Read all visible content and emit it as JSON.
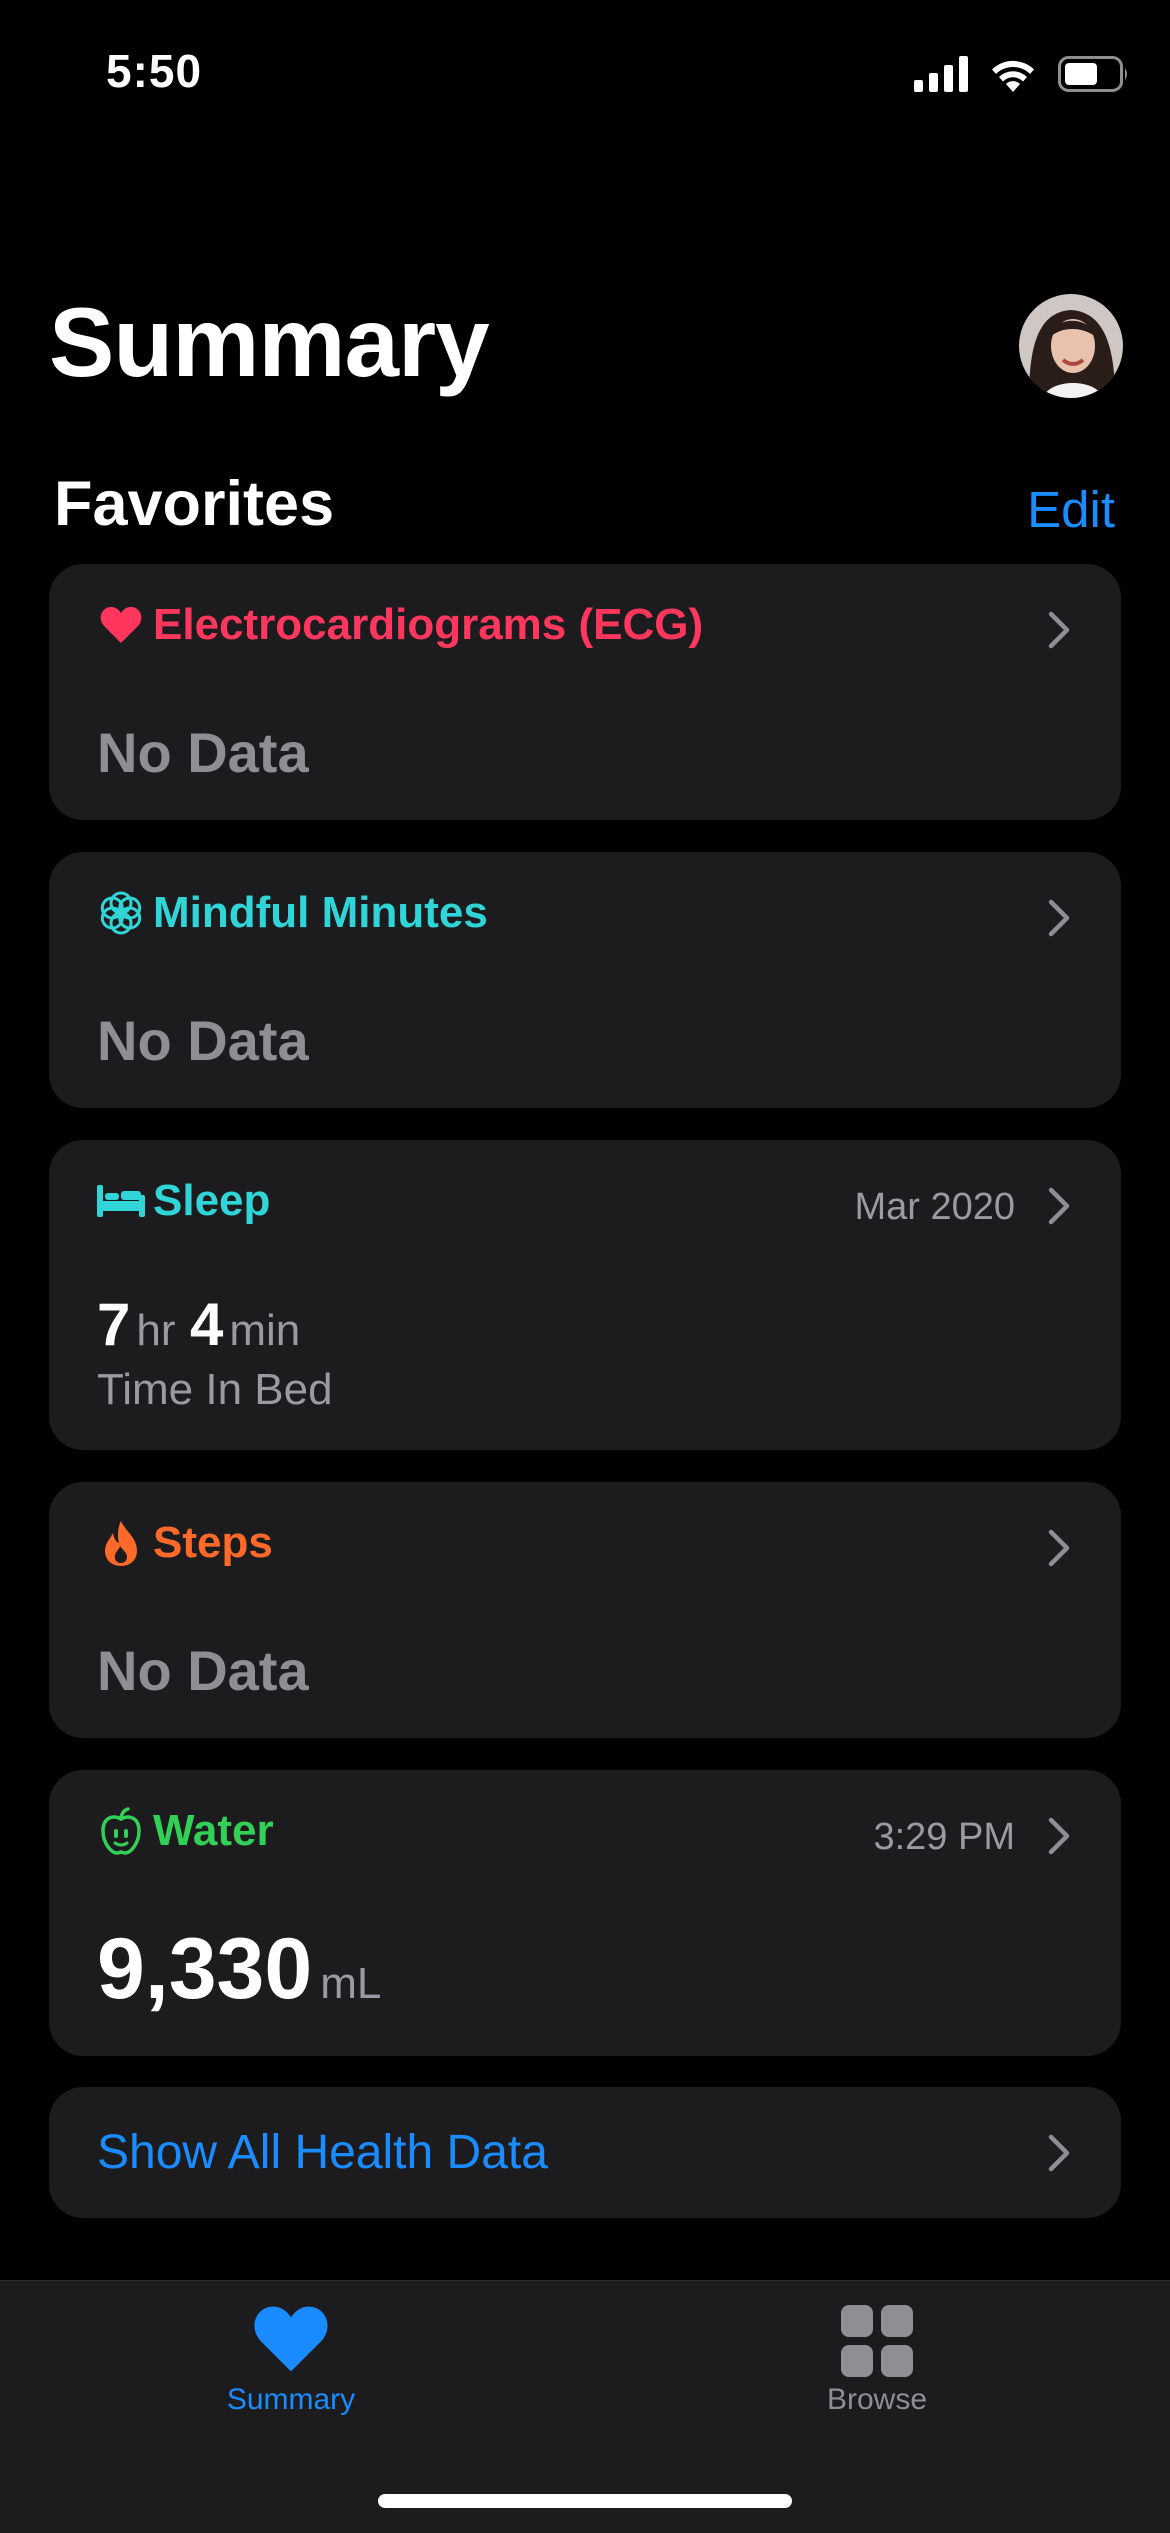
{
  "status_bar": {
    "time": "5:50"
  },
  "header": {
    "title": "Summary"
  },
  "favorites": {
    "title": "Favorites",
    "edit_label": "Edit",
    "cards": [
      {
        "name": "ecg",
        "title": "Electrocardiograms (ECG)",
        "value": "No Data",
        "color": "#ff375f",
        "icon": "heart-icon"
      },
      {
        "name": "mindful",
        "title": "Mindful Minutes",
        "value": "No Data",
        "color": "#30d5d8",
        "icon": "flower-icon"
      },
      {
        "name": "sleep",
        "title": "Sleep",
        "meta": "Mar 2020",
        "hours": "7",
        "hours_unit": "hr",
        "minutes": "4",
        "minutes_unit": "min",
        "caption": "Time In Bed",
        "color": "#30d5d8",
        "icon": "bed-icon"
      },
      {
        "name": "steps",
        "title": "Steps",
        "value": "No Data",
        "color": "#ff6a2a",
        "icon": "flame-icon"
      },
      {
        "name": "water",
        "title": "Water",
        "meta": "3:29 PM",
        "value": "9,330",
        "unit": "mL",
        "color": "#31d158",
        "icon": "apple-icon"
      }
    ]
  },
  "show_all": {
    "label": "Show All Health Data"
  },
  "tab_bar": {
    "tabs": [
      {
        "label": "Summary",
        "active": true,
        "icon": "heart-icon"
      },
      {
        "label": "Browse",
        "active": false,
        "icon": "grid-icon"
      }
    ]
  },
  "colors": {
    "accent": "#1a8cff",
    "card_bg": "#1c1c1e",
    "secondary_text": "#8e8e93"
  }
}
